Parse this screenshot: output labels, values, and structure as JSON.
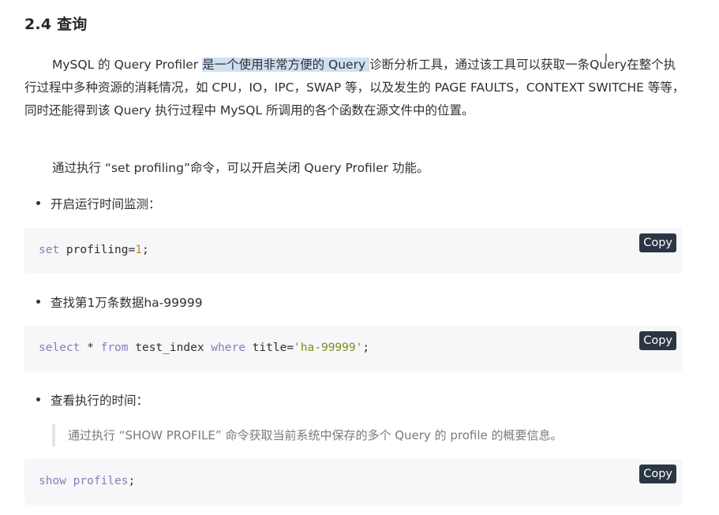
{
  "section": {
    "title": "2.4 查询"
  },
  "intro": {
    "part_before": "MySQL 的 Query Profiler ",
    "part_highlight": "是一个使用非常方便的 Query ",
    "part_after": "诊断分析工具，通过该工具可以获取一条Query在整个执行过程中多种资源的消耗情况，如 CPU，IO，IPC，SWAP 等，以及发生的 PAGE FAULTS，CONTEXT SWITCHE 等等，同时还能得到该 Query 执行过程中 MySQL 所调用的各个函数在源文件中的位置。"
  },
  "enable_note": "通过执行 “set profiling”命令，可以开启关闭 Query Profiler 功能。",
  "bullets": [
    "开启运行时间监测：",
    "查找第1万条数据ha-99999",
    "查看执行的时间："
  ],
  "code_blocks": [
    {
      "kw1": "set",
      "text1": " profiling=",
      "num": "1",
      "text2": ";"
    },
    {
      "kw1": "select",
      "text1": " * ",
      "kw2": "from",
      "text2": " test_index ",
      "kw3": "where",
      "text3": " title=",
      "str": "'ha-99999'",
      "text4": ";"
    },
    {
      "kw1": "show",
      "text1": " ",
      "kw2": "profiles",
      "text2": ";"
    }
  ],
  "copy_label": "Copy",
  "quote": "通过执行 “SHOW PROFILE” 命令获取当前系统中保存的多个 Query 的 profile 的概要信息。",
  "colors": {
    "highlight": "#cfe0f3",
    "code_bg": "#f6f7f8",
    "copy_bg": "#2b3644",
    "keyword": "#8a7cb8",
    "number": "#c98a1e",
    "string": "#7a8f1a"
  }
}
